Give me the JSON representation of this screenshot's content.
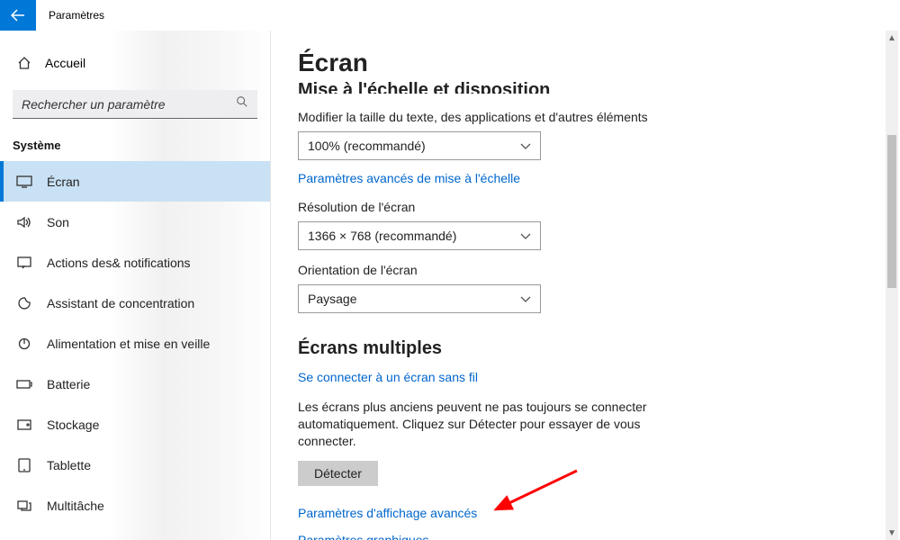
{
  "titlebar": {
    "title": "Paramètres"
  },
  "sidebar": {
    "home_label": "Accueil",
    "search_placeholder": "Rechercher un paramètre",
    "category_label": "Système",
    "items": [
      {
        "label": "Écran",
        "icon": "display-icon",
        "active": true
      },
      {
        "label": "Son",
        "icon": "sound-icon"
      },
      {
        "label": "Actions des& notifications",
        "icon": "notifications-icon"
      },
      {
        "label": "Assistant de concentration",
        "icon": "focus-icon"
      },
      {
        "label": "Alimentation et mise en veille",
        "icon": "power-icon"
      },
      {
        "label": "Batterie",
        "icon": "battery-icon"
      },
      {
        "label": "Stockage",
        "icon": "storage-icon"
      },
      {
        "label": "Tablette",
        "icon": "tablet-icon"
      },
      {
        "label": "Multitâche",
        "icon": "multitask-icon"
      }
    ]
  },
  "content": {
    "page_title": "Écran",
    "truncated_heading": "Mise à l'échelle et disposition",
    "scale_label": "Modifier la taille du texte, des applications et d'autres éléments",
    "scale_value": "100% (recommandé)",
    "scale_advanced_link": "Paramètres avancés de mise à l'échelle",
    "resolution_label": "Résolution de l'écran",
    "resolution_value": "1366 × 768 (recommandé)",
    "orientation_label": "Orientation de l'écran",
    "orientation_value": "Paysage",
    "multi_heading": "Écrans multiples",
    "wireless_link": "Se connecter à un écran sans fil",
    "detect_help": "Les écrans plus anciens peuvent ne pas toujours se connecter automatiquement. Cliquez sur Détecter pour essayer de vous connecter.",
    "detect_button": "Détecter",
    "advanced_display_link": "Paramètres d'affichage avancés",
    "graphics_link": "Paramètres graphiques"
  }
}
